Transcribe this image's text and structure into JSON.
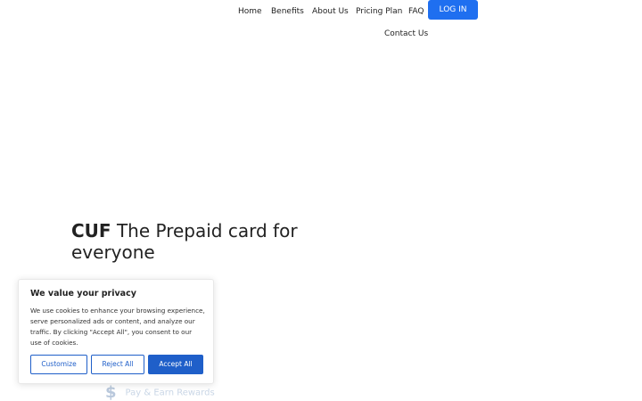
{
  "nav": {
    "items": [
      {
        "label": "Home"
      },
      {
        "label": "Benefits"
      },
      {
        "label": "About Us"
      },
      {
        "label": "Pricing Plan"
      },
      {
        "label": "FAQ"
      },
      {
        "label": "Contact Us"
      }
    ],
    "login_label": "LOG IN",
    "accent_color": "#1f6ff0"
  },
  "hero": {
    "brand": "CUF",
    "title_rest": " The Prepaid card for everyone"
  },
  "feature_hint": {
    "icon": "dollar-icon",
    "text": "Pay & Earn Rewards"
  },
  "cookie_banner": {
    "title": "We value your privacy",
    "text": "We use cookies to enhance your browsing experience, serve personalized ads or content, and analyze our traffic. By clicking \"Accept All\", you consent to our use of cookies.",
    "customize_label": "Customize",
    "reject_label": "Reject All",
    "accept_label": "Accept All",
    "button_color": "#1f5fc9"
  }
}
